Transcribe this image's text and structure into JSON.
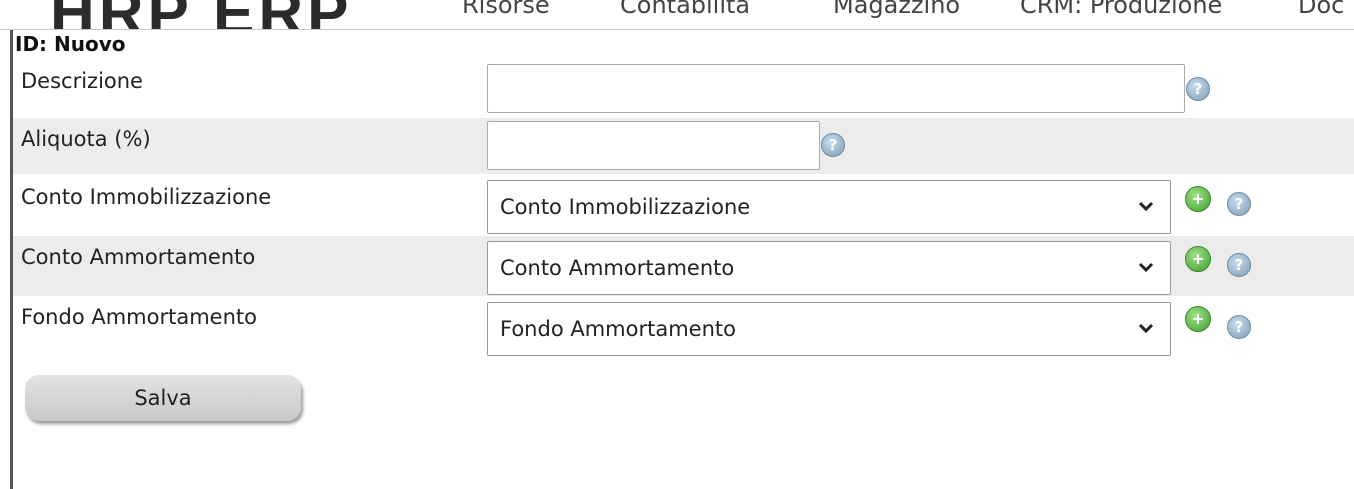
{
  "header": {
    "logo_fragment": "HRP ERP",
    "nav": [
      "Risorse",
      "Contabilità",
      "Magazzino",
      "CRM: Produzione",
      "Doc"
    ]
  },
  "form": {
    "title": "ID: Nuovo",
    "descrizione": {
      "label": "Descrizione",
      "value": ""
    },
    "aliquota": {
      "label": "Aliquota (%)",
      "value": ""
    },
    "conto_immobilizzazione": {
      "label": "Conto Immobilizzazione",
      "selected": "Conto Immobilizzazione"
    },
    "conto_ammortamento": {
      "label": "Conto Ammortamento",
      "selected": "Conto Ammortamento"
    },
    "fondo_ammortamento": {
      "label": "Fondo Ammortamento",
      "selected": "Fondo Ammortamento"
    },
    "help_glyph": "?",
    "save_label": "Salva"
  },
  "icons": {
    "help": "help-icon",
    "add": "add-icon",
    "dropdown": "chevron-down-icon"
  },
  "colors": {
    "row_alt_bg": "#ececec",
    "help_blue": "#7f9fb8",
    "add_green": "#3f9f2f",
    "button_grey": "#d0d0d0"
  }
}
